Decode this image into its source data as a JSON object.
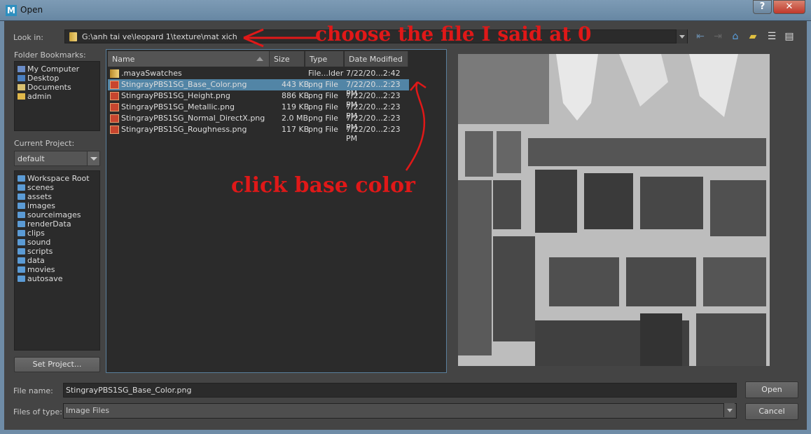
{
  "window": {
    "title": "Open",
    "help_button": "?",
    "close_button": "✕"
  },
  "look_in": {
    "label": "Look in:",
    "path": "G:\\anh tai ve\\leopard 1\\texture\\mat xich"
  },
  "toolbar_icons": [
    "back-icon",
    "forward-icon",
    "home-icon",
    "new-folder-icon",
    "list-view-icon",
    "detail-view-icon"
  ],
  "bookmarks": {
    "label": "Folder Bookmarks:",
    "items": [
      {
        "label": "My Computer",
        "icon": "computer-icon"
      },
      {
        "label": "Desktop",
        "icon": "desktop-icon"
      },
      {
        "label": "Documents",
        "icon": "documents-icon"
      },
      {
        "label": "admin",
        "icon": "user-folder-icon"
      }
    ]
  },
  "current_project": {
    "label": "Current Project:",
    "value": "default",
    "items": [
      "Workspace Root",
      "scenes",
      "assets",
      "images",
      "sourceimages",
      "renderData",
      "clips",
      "sound",
      "scripts",
      "data",
      "movies",
      "autosave"
    ],
    "set_project_button": "Set Project..."
  },
  "file_list": {
    "columns": [
      "Name",
      "Size",
      "Type",
      "Date Modified"
    ],
    "rows": [
      {
        "name": ".mayaSwatches",
        "size": "",
        "type": "File...lder",
        "date": "7/22/20...2:42 PM",
        "icon": "folder-icon",
        "selected": false
      },
      {
        "name": "StingrayPBS1SG_Base_Color.png",
        "size": "443 KB",
        "type": "png File",
        "date": "7/22/20...2:23 PM",
        "icon": "png-file-icon",
        "selected": true
      },
      {
        "name": "StingrayPBS1SG_Height.png",
        "size": "886 KB",
        "type": "png File",
        "date": "7/22/20...2:23 PM",
        "icon": "png-file-icon",
        "selected": false
      },
      {
        "name": "StingrayPBS1SG_Metallic.png",
        "size": "119 KB",
        "type": "png File",
        "date": "7/22/20...2:23 PM",
        "icon": "png-file-icon",
        "selected": false
      },
      {
        "name": "StingrayPBS1SG_Normal_DirectX.png",
        "size": "2.0 MB",
        "type": "png File",
        "date": "7/22/20...2:23 PM",
        "icon": "png-file-icon",
        "selected": false
      },
      {
        "name": "StingrayPBS1SG_Roughness.png",
        "size": "117 KB",
        "type": "png File",
        "date": "7/22/20...2:23 PM",
        "icon": "png-file-icon",
        "selected": false
      }
    ]
  },
  "file_name": {
    "label": "File name:",
    "value": "StingrayPBS1SG_Base_Color.png"
  },
  "file_type": {
    "label": "Files of type:",
    "value": "Image Files"
  },
  "buttons": {
    "open": "Open",
    "cancel": "Cancel"
  },
  "annotations": {
    "choose_file": "choose the file I said at 0",
    "click_base": "click base color"
  },
  "colors": {
    "selection": "#5285a6",
    "annotation": "#e01818",
    "titlebar": "#6f8ca7"
  }
}
